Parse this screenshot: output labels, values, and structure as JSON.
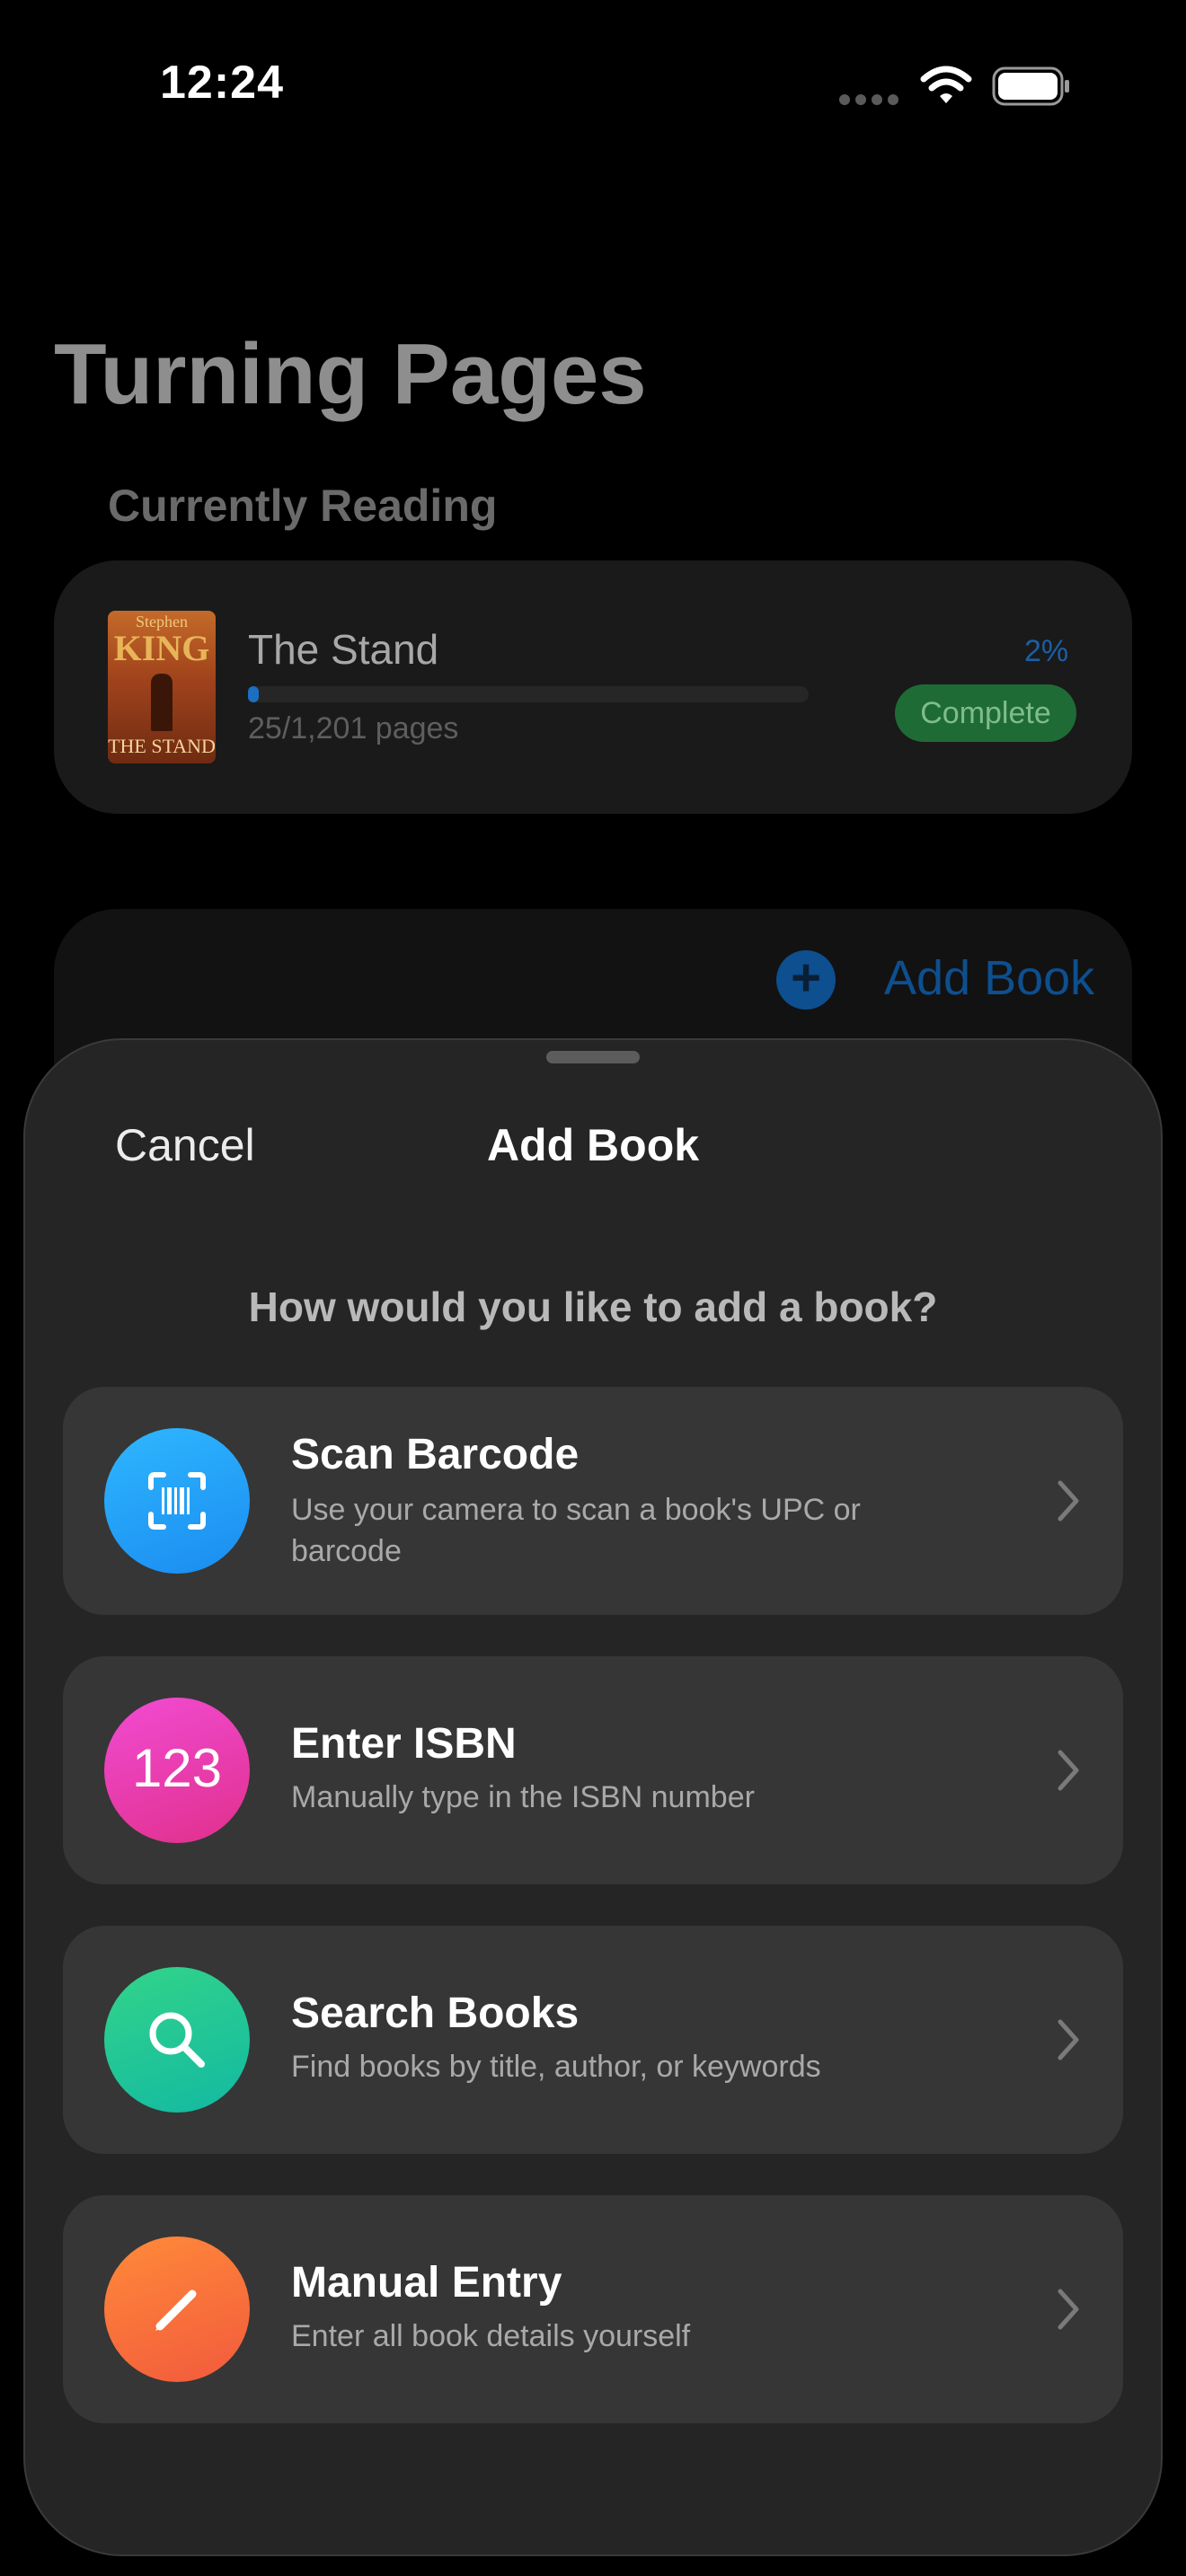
{
  "status_bar": {
    "time": "12:24"
  },
  "background": {
    "title": "Turning Pages",
    "section_label": "Currently Reading",
    "book": {
      "cover_author": "Stephen",
      "cover_brand": "KING",
      "cover_title": "THE STAND",
      "title": "The Stand",
      "progress_fraction": 0.02,
      "pages": "25/1,201 pages",
      "percent": "2%",
      "badge": "Complete"
    },
    "add_book_label": "Add Book"
  },
  "sheet": {
    "cancel_label": "Cancel",
    "title": "Add Book",
    "prompt": "How would you like to add a book?",
    "options": [
      {
        "title": "Scan Barcode",
        "description": "Use your camera to scan a book's UPC or barcode",
        "icon": "barcode-viewfinder-icon",
        "color_top": "#2fb7ff",
        "color_bottom": "#1a8cf0"
      },
      {
        "title": "Enter ISBN",
        "description": "Manually type in the ISBN number",
        "icon": "number-icon",
        "icon_text": "123",
        "color_top": "#f24bd3",
        "color_bottom": "#e0308c"
      },
      {
        "title": "Search Books",
        "description": "Find books by title, author, or keywords",
        "icon": "magnifying-glass-icon",
        "color_top": "#33d489",
        "color_bottom": "#12b9a2"
      },
      {
        "title": "Manual Entry",
        "description": "Enter all book details yourself",
        "icon": "pencil-icon",
        "color_top": "#ff8a3a",
        "color_bottom": "#f25a3c"
      }
    ]
  }
}
